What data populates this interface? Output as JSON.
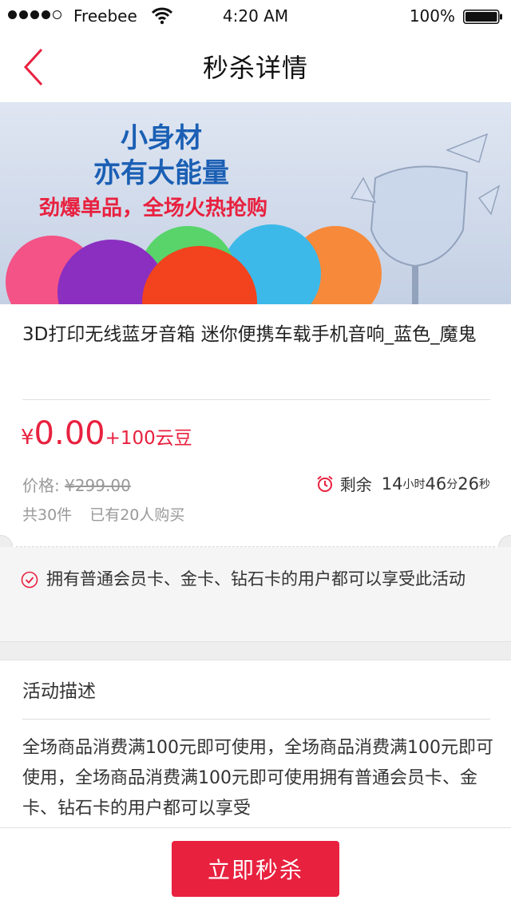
{
  "status_bar": {
    "carrier": "Freebee",
    "time": "4:20 AM",
    "battery": "100%"
  },
  "nav": {
    "title": "秒杀详情",
    "back_icon": "chevron-left-icon"
  },
  "banner": {
    "headline_line1": "小身材",
    "headline_line2": "亦有大能量",
    "tagline": "劲爆单品，全场火热抢购",
    "colors": {
      "headline": "#1a5fb4",
      "tagline": "#e8213f"
    }
  },
  "product": {
    "title": "3D打印无线蓝牙音箱 迷你便携车载手机音响_蓝色_魔鬼"
  },
  "price": {
    "currency": "¥",
    "amount": "0.00",
    "bonus": "+100云豆",
    "original_label": "价格:",
    "original_value": "¥299.00",
    "accent_color": "#e8213f"
  },
  "timer": {
    "icon": "alarm-clock-icon",
    "label": "剩余",
    "hours": "14",
    "hours_unit": "小时",
    "minutes": "46",
    "minutes_unit": "分",
    "seconds": "26",
    "seconds_unit": "秒"
  },
  "stock": {
    "total": "共30件",
    "bought": "已有20人购买"
  },
  "benefit": {
    "icon": "check-circle-icon",
    "text": "拥有普通会员卡、金卡、钻石卡的用户都可以享受此活动"
  },
  "description": {
    "heading": "活动描述",
    "body": "全场商品消费满100元即可使用，全场商品消费满100元即可使用，全场商品消费满100元即可使用拥有普通会员卡、金卡、钻石卡的用户都可以享受"
  },
  "action": {
    "buy_label": "立即秒杀"
  }
}
